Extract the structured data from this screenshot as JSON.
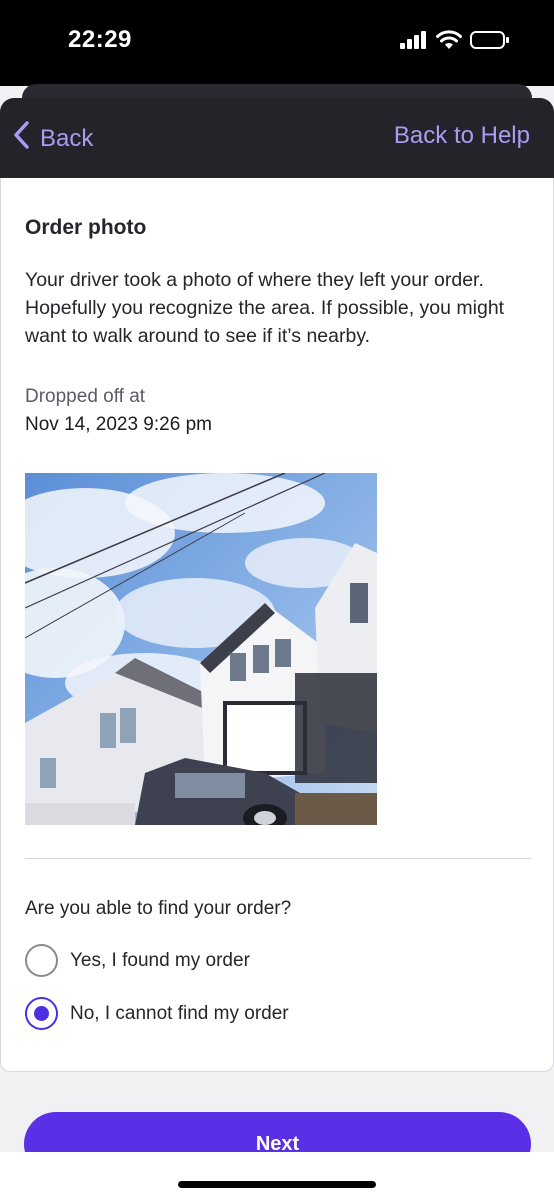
{
  "status_bar": {
    "time": "22:29",
    "icons": [
      "signal-icon",
      "wifi-icon",
      "battery-icon"
    ]
  },
  "header": {
    "back_label": "Back",
    "help_label": "Back to Help",
    "accent_color": "#a99cf2"
  },
  "card": {
    "title": "Order photo",
    "description": "Your driver took a photo of where they left your order. Hopefully you recognize the area. If possible, you might want to walk around to see if it’s nearby.",
    "dropped_label": "Dropped off at",
    "dropped_date": "Nov 14, 2023 9:26 pm",
    "question": "Are you able to find your order?",
    "options": [
      {
        "label": "Yes, I found my order",
        "selected": false
      },
      {
        "label": "No, I cannot find my order",
        "selected": true
      }
    ]
  },
  "footer": {
    "next_label": "Next",
    "button_color": "#5b2fe6"
  }
}
